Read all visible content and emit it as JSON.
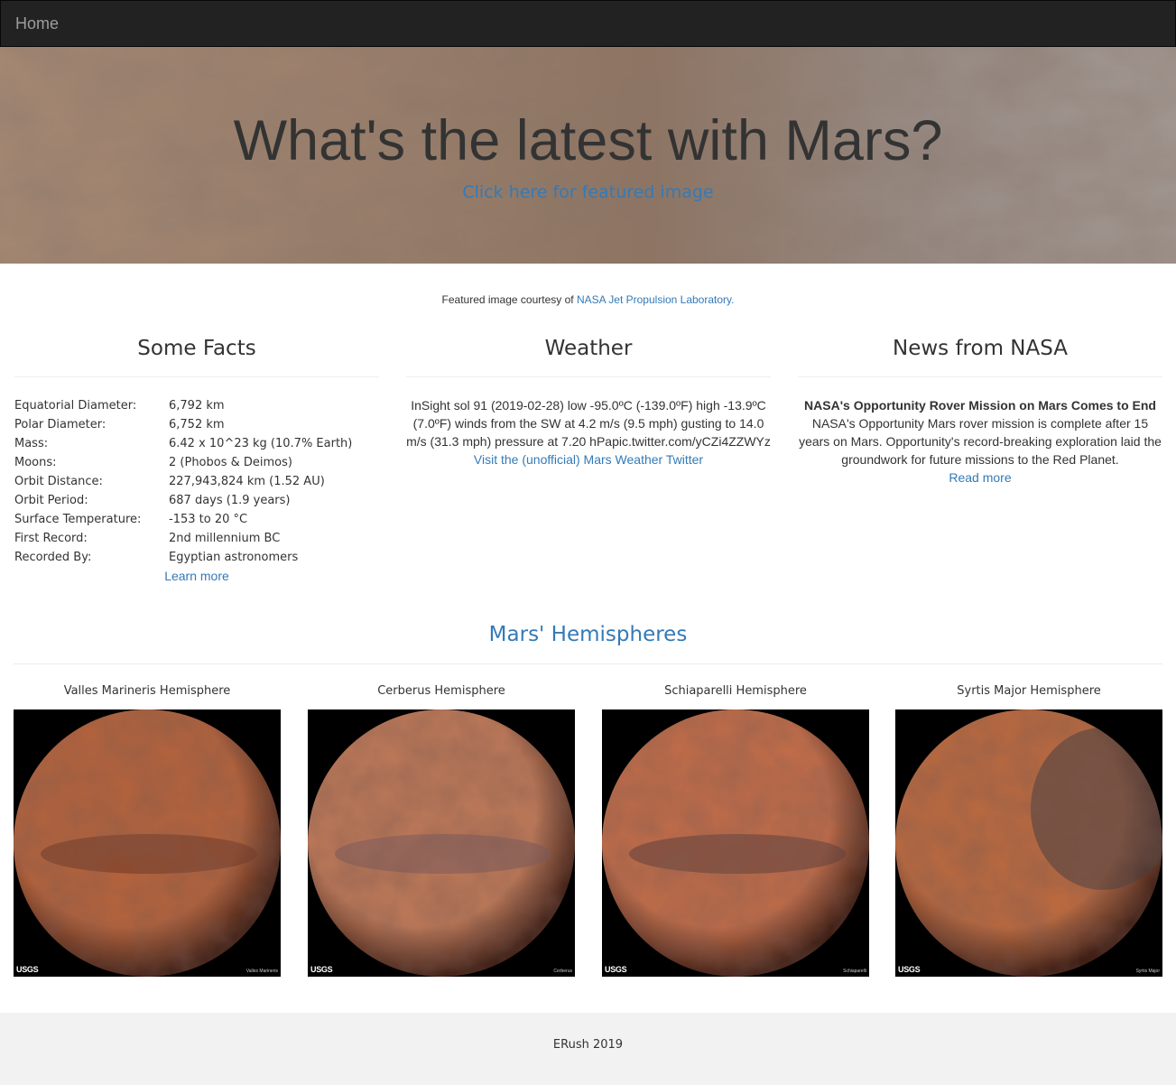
{
  "navbar": {
    "brand": "Home"
  },
  "jumbotron": {
    "title": "What's the latest with Mars?",
    "featured_link": "Click here for featured image"
  },
  "credit": {
    "prefix": "Featured image courtesy of ",
    "link": "NASA Jet Propulsion Laboratory."
  },
  "facts": {
    "heading": "Some Facts",
    "rows": [
      {
        "label": "Equatorial Diameter:",
        "value": "6,792 km"
      },
      {
        "label": "Polar Diameter:",
        "value": "6,752 km"
      },
      {
        "label": "Mass:",
        "value": "6.42 x 10^23 kg (10.7% Earth)"
      },
      {
        "label": "Moons:",
        "value": "2 (Phobos & Deimos)"
      },
      {
        "label": "Orbit Distance:",
        "value": "227,943,824 km (1.52 AU)"
      },
      {
        "label": "Orbit Period:",
        "value": "687 days (1.9 years)"
      },
      {
        "label": "Surface Temperature:",
        "value": "-153 to 20 °C"
      },
      {
        "label": "First Record:",
        "value": "2nd millennium BC"
      },
      {
        "label": "Recorded By:",
        "value": "Egyptian astronomers"
      }
    ],
    "learn_more": "Learn more"
  },
  "weather": {
    "heading": "Weather",
    "text": "InSight sol 91 (2019-02-28) low -95.0ºC (-139.0ºF) high -13.9ºC (7.0ºF) winds from the SW at 4.2 m/s (9.5 mph) gusting to 14.0 m/s (31.3 mph) pressure at 7.20 hPapic.twitter.com/yCZi4ZZWYz",
    "link": "Visit the (unofficial) Mars Weather Twitter"
  },
  "news": {
    "heading": "News from NASA",
    "title": "NASA's Opportunity Rover Mission on Mars Comes to End",
    "body": "NASA's Opportunity Mars rover mission is complete after 15 years on Mars. Opportunity's record-breaking exploration laid the groundwork for future missions to the Red Planet.",
    "read_more": "Read more"
  },
  "hemispheres": {
    "heading": "Mars' Hemispheres",
    "items": [
      {
        "title": "Valles Marineris Hemisphere",
        "caption": "Valles Marineris",
        "base": "#b7633a",
        "dark": "#6b3420"
      },
      {
        "title": "Cerberus Hemisphere",
        "caption": "Cerberus",
        "base": "#c07a58",
        "dark": "#7a5a5e"
      },
      {
        "title": "Schiaparelli Hemisphere",
        "caption": "Schiaparelli",
        "base": "#c46d48",
        "dark": "#5a3a38"
      },
      {
        "title": "Syrtis Major Hemisphere",
        "caption": "Syrtis Major",
        "base": "#bd6a3e",
        "dark": "#3c3a40"
      }
    ],
    "usgs_label": "USGS"
  },
  "footer": {
    "text": "ERush 2019"
  }
}
